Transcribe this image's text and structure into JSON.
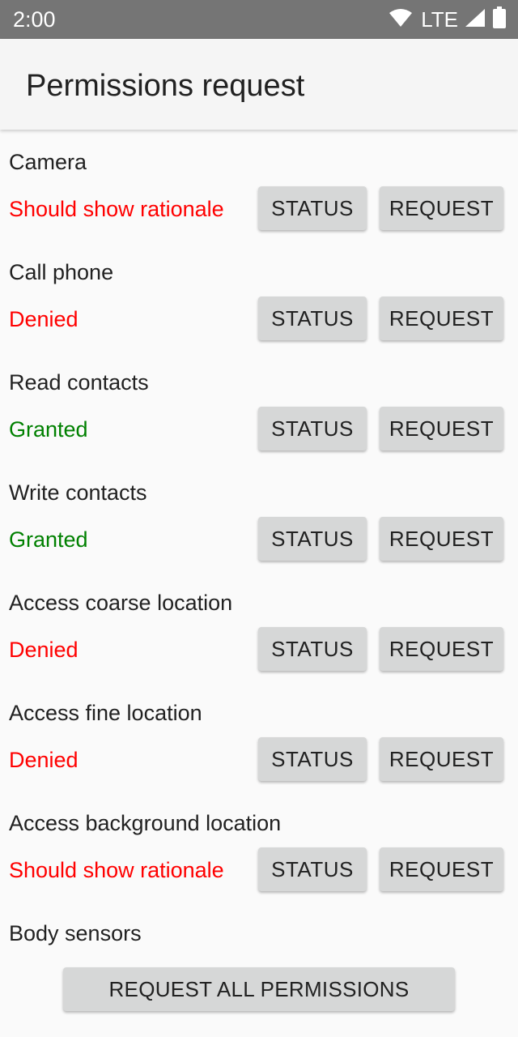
{
  "status_bar": {
    "time": "2:00",
    "network": "LTE",
    "icons": [
      "wifi-icon",
      "signal-icon",
      "battery-icon"
    ]
  },
  "app_bar": {
    "title": "Permissions request"
  },
  "colors": {
    "denied": "#ff0000",
    "granted": "#008000",
    "button": "#d6d7d7"
  },
  "permissions": [
    {
      "name": "Camera",
      "status": "Should show rationale",
      "state": "denied",
      "status_button": "STATUS",
      "request_button": "REQUEST"
    },
    {
      "name": "Call phone",
      "status": "Denied",
      "state": "denied",
      "status_button": "STATUS",
      "request_button": "REQUEST"
    },
    {
      "name": "Read contacts",
      "status": "Granted",
      "state": "granted",
      "status_button": "STATUS",
      "request_button": "REQUEST"
    },
    {
      "name": "Write contacts",
      "status": "Granted",
      "state": "granted",
      "status_button": "STATUS",
      "request_button": "REQUEST"
    },
    {
      "name": "Access coarse location",
      "status": "Denied",
      "state": "denied",
      "status_button": "STATUS",
      "request_button": "REQUEST"
    },
    {
      "name": "Access fine location",
      "status": "Denied",
      "state": "denied",
      "status_button": "STATUS",
      "request_button": "REQUEST"
    },
    {
      "name": "Access background location",
      "status": "Should show rationale",
      "state": "denied",
      "status_button": "STATUS",
      "request_button": "REQUEST"
    },
    {
      "name": "Body sensors"
    }
  ],
  "request_all_label": "REQUEST ALL PERMISSIONS"
}
